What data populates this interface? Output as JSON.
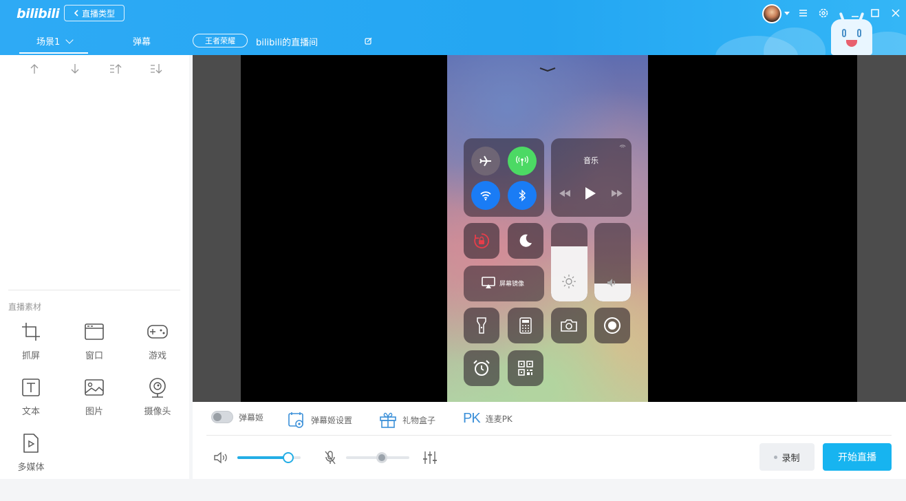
{
  "app": {
    "logo_text": "bilibili",
    "back_button_label": "直播类型"
  },
  "tabs": {
    "scene_label": "场景1",
    "danmaku_label": "弹幕"
  },
  "room": {
    "category_tag": "王者荣耀",
    "title": "bilibili的直播间"
  },
  "window_controls": [
    "avatar",
    "menu-icon",
    "settings-icon",
    "minimize-icon",
    "maximize-icon",
    "close-icon"
  ],
  "sidebar": {
    "order_icons": [
      "move-up-icon",
      "move-down-icon",
      "move-top-icon",
      "move-bottom-icon"
    ],
    "section_title": "直播素材",
    "assets": [
      {
        "label": "抓屏",
        "icon": "crop-icon"
      },
      {
        "label": "窗口",
        "icon": "window-icon"
      },
      {
        "label": "游戏",
        "icon": "gamepad-icon"
      },
      {
        "label": "文本",
        "icon": "text-icon"
      },
      {
        "label": "图片",
        "icon": "image-icon"
      },
      {
        "label": "摄像头",
        "icon": "camera-icon"
      },
      {
        "label": "多媒体",
        "icon": "media-file-icon"
      }
    ]
  },
  "preview": {
    "control_center": {
      "music_title": "音乐",
      "screen_mirror_label": "屏幕镜像"
    }
  },
  "controls": {
    "danmaku_ji_label": "弹幕姬",
    "danmaku_ji_settings_label": "弹幕姬设置",
    "gift_box_label": "礼物盒子",
    "pk_label": "连麦PK",
    "pk_badge": "PK",
    "speaker_volume": 0.8,
    "mic_volume": 0.56,
    "record_label": "录制",
    "start_live_label": "开始直播"
  },
  "colors": {
    "brand": "#23a6f2",
    "start_button": "#17b4f0",
    "accent": "#23ade5"
  }
}
